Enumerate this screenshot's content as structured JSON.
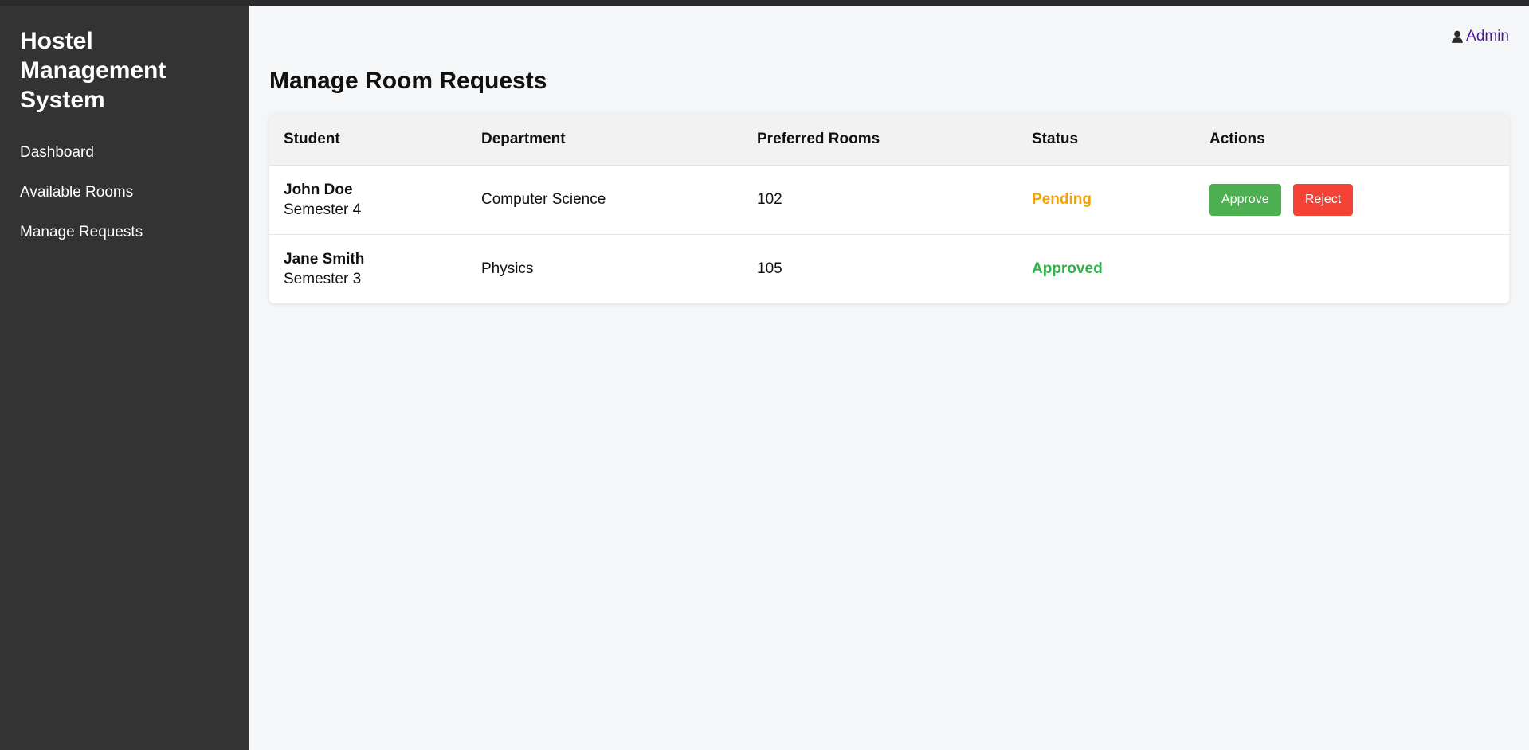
{
  "sidebar": {
    "brand": "Hostel Management System",
    "nav": [
      {
        "label": "Dashboard"
      },
      {
        "label": "Available Rooms"
      },
      {
        "label": "Manage Requests"
      }
    ]
  },
  "header": {
    "user_label": "Admin",
    "user_icon": "user-icon"
  },
  "main": {
    "title": "Manage Room Requests",
    "table": {
      "columns": [
        "Student",
        "Department",
        "Preferred Rooms",
        "Status",
        "Actions"
      ],
      "rows": [
        {
          "name": "John Doe",
          "semester": "Semester 4",
          "department": "Computer Science",
          "preferred_rooms": "102",
          "status": "Pending",
          "actions": {
            "approve": "Approve",
            "reject": "Reject"
          }
        },
        {
          "name": "Jane Smith",
          "semester": "Semester 3",
          "department": "Physics",
          "preferred_rooms": "105",
          "status": "Approved"
        }
      ]
    }
  },
  "colors": {
    "sidebar_bg": "#333333",
    "pending": "#f0a30a",
    "approved": "#2fb34a",
    "approve_button": "#4caf50",
    "reject_button": "#f44336",
    "user_link": "#4b1a8f"
  }
}
